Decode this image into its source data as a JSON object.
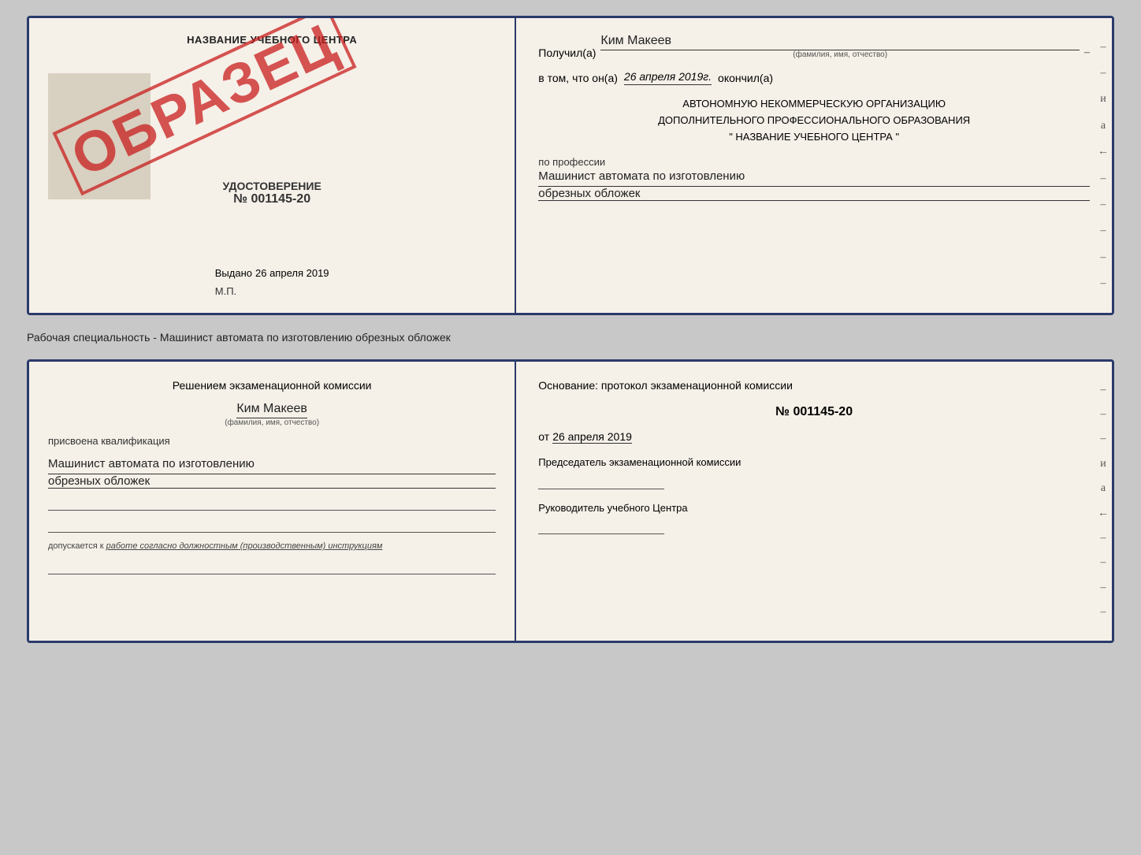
{
  "top_document": {
    "left": {
      "school_name": "НАЗВАНИЕ УЧЕБНОГО ЦЕНТРА",
      "cert_label": "УДОСТОВЕРЕНИЕ",
      "cert_number": "№ 001145-20",
      "stamp_text": "ОБРАЗЕЦ",
      "issued_label": "Выдано",
      "issued_date": "26 апреля 2019",
      "mp_label": "М.П."
    },
    "right": {
      "received_label": "Получил(а)",
      "recipient_name": "Ким Макеев",
      "fio_hint": "(фамилия, имя, отчество)",
      "date_intro": "в том, что он(а)",
      "date_value": "26 апреля 2019г.",
      "date_suffix": "окончил(а)",
      "org_line1": "АВТОНОМНУЮ НЕКОММЕРЧЕСКУЮ ОРГАНИЗАЦИЮ",
      "org_line2": "ДОПОЛНИТЕЛЬНОГО ПРОФЕССИОНАЛЬНОГО ОБРАЗОВАНИЯ",
      "org_name": "\" НАЗВАНИЕ УЧЕБНОГО ЦЕНТРА \"",
      "profession_label": "по профессии",
      "profession_line1": "Машинист автомата по изготовлению",
      "profession_line2": "обрезных обложек"
    }
  },
  "subtitle": "Рабочая специальность - Машинист автомата по изготовлению обрезных обложек",
  "bottom_document": {
    "left": {
      "header_line1": "Решением экзаменационной комиссии",
      "commission_name": "Ким Макеев",
      "fio_hint": "(фамилия, имя, отчество)",
      "qualification_label": "присвоена квалификация",
      "qualification_line1": "Машинист автомата по изготовлению",
      "qualification_line2": "обрезных обложек",
      "admission_text": "допускается к",
      "admission_italic": "работе согласно должностным (производственным) инструкциям"
    },
    "right": {
      "basis_label": "Основание: протокол экзаменационной комиссии",
      "protocol_number": "№ 001145-20",
      "protocol_date_prefix": "от",
      "protocol_date": "26 апреля 2019",
      "chairman_label": "Председатель экзаменационной комиссии",
      "director_label": "Руководитель учебного Центра"
    }
  },
  "right_side_chars": {
    "chars": [
      "–",
      "–",
      "и",
      "а",
      "←",
      "–",
      "–",
      "–",
      "–",
      "–"
    ],
    "bottom_chars": [
      "–",
      "–",
      "–",
      "и",
      "а",
      "←",
      "–",
      "–",
      "–",
      "–"
    ]
  }
}
